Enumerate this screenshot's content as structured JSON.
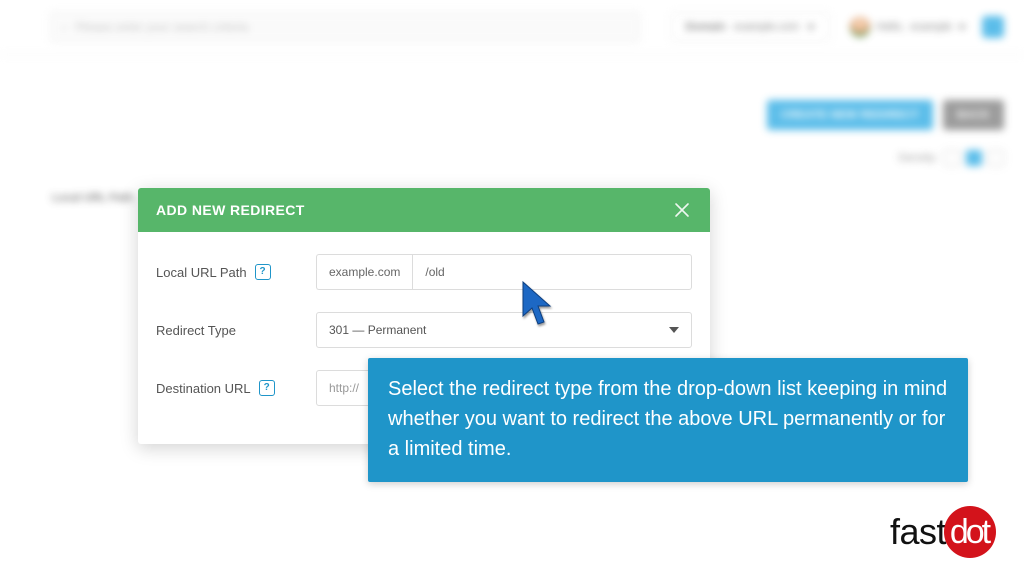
{
  "topbar": {
    "search_placeholder": "Please enter your search criteria",
    "domain_label": "Domain",
    "domain_value": "example.com",
    "hello_prefix": "Hello,",
    "hello_user": "example"
  },
  "buttons": {
    "create": "CREATE NEW REDIRECT",
    "back": "BACK"
  },
  "density_label": "Density:",
  "table": {
    "col_local": "Local URL Path"
  },
  "modal": {
    "title": "ADD NEW REDIRECT",
    "local_label": "Local URL Path",
    "local_prefix": "example.com",
    "local_value": "/old",
    "type_label": "Redirect Type",
    "type_value": "301 — Permanent",
    "dest_label": "Destination URL",
    "dest_value": "http://",
    "help_symbol": "?"
  },
  "callout": "Select the redirect type from the drop-down list keeping in mind whether you want to redirect the above URL permanently or for a limited time.",
  "brand": {
    "a": "fast",
    "b": "dot"
  }
}
